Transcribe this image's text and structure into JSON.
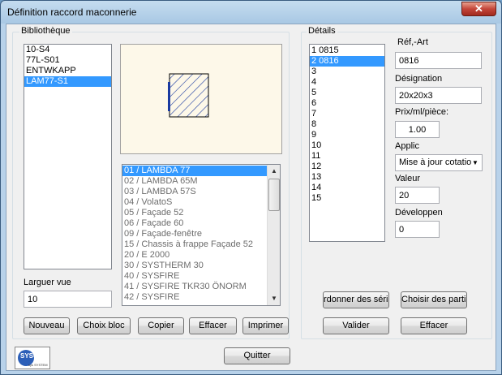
{
  "window": {
    "title": "Définition raccord maconnerie",
    "close_glyph": "✕"
  },
  "bibliotheque": {
    "label": "Bibliothèque",
    "items": [
      "10-S4",
      "77L-S01",
      "ENTWKAPP",
      "LAM77-S1"
    ],
    "selected_index": 3
  },
  "systems": {
    "items": [
      "01 / LAMBDA 77",
      "02 / LAMBDA 65M",
      "03 / LAMBDA 57S",
      "04 / VolatoS",
      "05 / Façade  52",
      "06 / Façade  60",
      "09 / Façade-fenêtre",
      "15 / Chassis à frappe  Façade  52",
      "20 / E 2000",
      "30 / SYSTHERM 30",
      "40 / SYSFIRE",
      "41 / SYSFIRE TKR30 ÖNORM",
      "42 / SYSFIRE"
    ],
    "selected_index": 0,
    "scroll_up": "▲",
    "scroll_down": "▼"
  },
  "largeur": {
    "label": "Larguer vue",
    "value": "10"
  },
  "buttons": {
    "nouveau": "Nouveau",
    "choix_bloc": "Choix bloc",
    "copier": "Copier",
    "effacer_left": "Effacer",
    "imprimer": "Imprimer",
    "ordonner": "rdonner des série",
    "choisir": "Choisir des partie",
    "valider": "Valider",
    "effacer_right": "Effacer",
    "quitter": "Quitter"
  },
  "details": {
    "label": "Détails",
    "items": [
      "1  0815",
      "2  0816",
      "3",
      "4",
      "5",
      "6",
      "7",
      "8",
      "9",
      "10",
      "11",
      "12",
      "13",
      "14",
      "15"
    ],
    "selected_index": 1
  },
  "fields": {
    "ref_label": "Réf,-Art",
    "ref_value": "0816",
    "designation_label": "Désignation",
    "designation_value": "20x20x3",
    "prix_label": "Prix/ml/pièce:",
    "prix_value": "1.00",
    "applic_label": "Applic",
    "applic_value": "Mise à jour cotatio",
    "valeur_label": "Valeur",
    "valeur_value": "20",
    "developpen_label": "Développen",
    "developpen_value": "0"
  },
  "logo": {
    "text": "SYSCAD",
    "subtext": "sys SYSTEM"
  },
  "colors": {
    "selection": "#3399ff",
    "preview_bg": "#fdf8e9",
    "hatch": "#1a3aa0"
  }
}
